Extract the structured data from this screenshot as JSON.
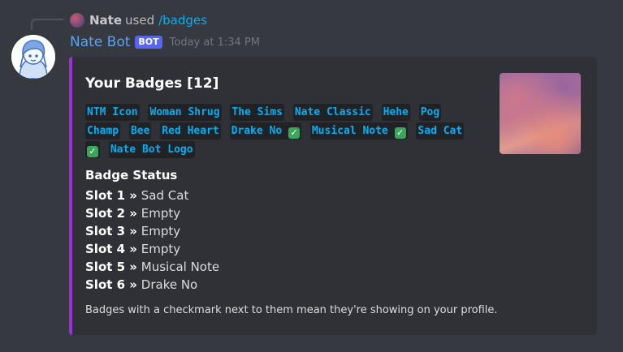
{
  "reply": {
    "user": "Nate",
    "action": "used",
    "command": "/badges"
  },
  "message": {
    "username": "Nate Bot",
    "bot_tag": "BOT",
    "timestamp": "Today at 1:34 PM"
  },
  "embed": {
    "title": "Your Badges [12]",
    "accent_color": "#9b30d9",
    "badges": [
      {
        "name": "NTM Icon",
        "showing": false
      },
      {
        "name": "Woman Shrug",
        "showing": false
      },
      {
        "name": "The Sims",
        "showing": false
      },
      {
        "name": "Nate Classic",
        "showing": false
      },
      {
        "name": "Hehe",
        "showing": false
      },
      {
        "name": "Pog Champ",
        "showing": false
      },
      {
        "name": "Bee",
        "showing": false
      },
      {
        "name": "Red Heart",
        "showing": false
      },
      {
        "name": "Drake No",
        "showing": true
      },
      {
        "name": "Musical Note",
        "showing": true
      },
      {
        "name": "Sad Cat",
        "showing": true
      },
      {
        "name": "Nate Bot Logo",
        "showing": false
      }
    ],
    "status_title": "Badge Status",
    "slots": [
      {
        "label": "Slot 1 »",
        "value": "Sad Cat"
      },
      {
        "label": "Slot 2 »",
        "value": "Empty"
      },
      {
        "label": "Slot 3 »",
        "value": "Empty"
      },
      {
        "label": "Slot 4 »",
        "value": "Empty"
      },
      {
        "label": "Slot 5 »",
        "value": "Musical Note"
      },
      {
        "label": "Slot 6 »",
        "value": "Drake No"
      }
    ],
    "footer": "Badges with a checkmark next to them mean they're showing on your profile."
  }
}
